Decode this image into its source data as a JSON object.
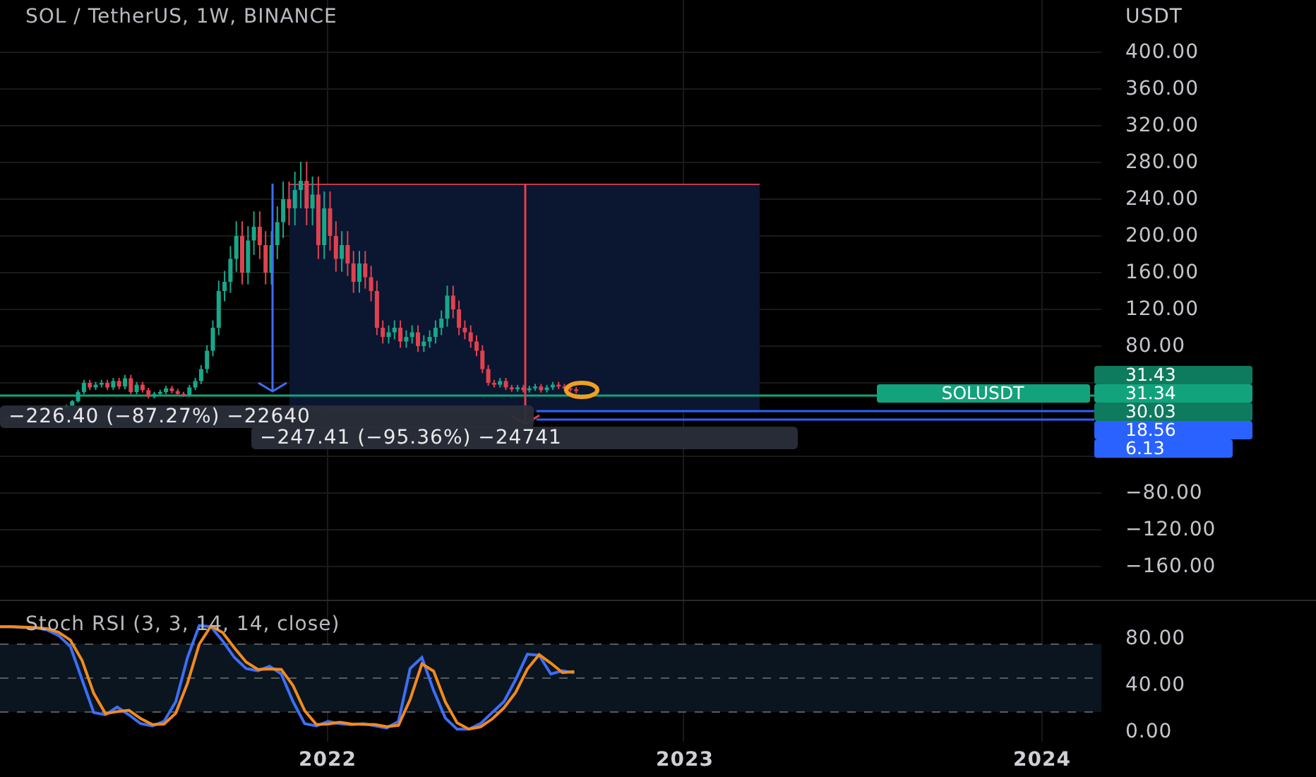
{
  "chart_title": "SOL / TetherUS, 1W, BINANCE",
  "price_axis": {
    "unit": "USDT",
    "upper_labels": [
      "400.00",
      "360.00",
      "320.00",
      "280.00",
      "240.00",
      "200.00",
      "160.00",
      "120.00",
      "80.00"
    ],
    "lower_labels": [
      "−80.00",
      "−120.00",
      "−160.00"
    ]
  },
  "price_tags": [
    {
      "text": "31.43",
      "color": "#0e7a5e"
    },
    {
      "text": "31.34",
      "color": "#12a37c",
      "label": "SOLUSDT"
    },
    {
      "text": "30.03",
      "color": "#0e7a5e"
    },
    {
      "text": "18.56",
      "color": "#2962ff"
    },
    {
      "text": "6.13",
      "color": "#2962ff"
    }
  ],
  "measurements": [
    "−226.40 (−87.27%) −22640",
    "−247.41 (−95.36%) −24741"
  ],
  "indicator": {
    "title": "Stoch RSI (3, 3, 14, 14, close)",
    "axis_labels": [
      "80.00",
      "40.00",
      "0.00"
    ]
  },
  "time_axis": [
    "2022",
    "2023",
    "2024"
  ]
}
